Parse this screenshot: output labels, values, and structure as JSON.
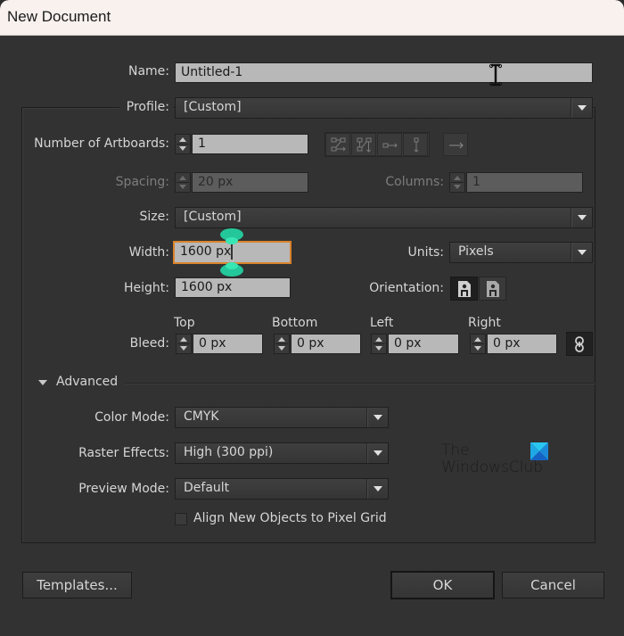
{
  "window": {
    "title": "New Document"
  },
  "form": {
    "name": {
      "label": "Name:",
      "value": "Untitled-1"
    },
    "profile": {
      "label": "Profile:",
      "value": "[Custom]"
    },
    "artboards": {
      "label": "Number of Artboards:",
      "value": "1"
    },
    "artboard_arrange_icons": [
      "grid-by-row-icon",
      "grid-by-column-icon",
      "arrange-by-row-icon",
      "arrange-by-column-icon",
      "right-to-left-layout-icon"
    ],
    "spacing": {
      "label": "Spacing:",
      "value": "20 px",
      "enabled": false
    },
    "columns": {
      "label": "Columns:",
      "value": "1",
      "enabled": false
    },
    "size": {
      "label": "Size:",
      "value": "[Custom]"
    },
    "width": {
      "label": "Width:",
      "value": "1600 px"
    },
    "units": {
      "label": "Units:",
      "value": "Pixels"
    },
    "height": {
      "label": "Height:",
      "value": "1600 px"
    },
    "orientation": {
      "label": "Orientation:",
      "selected": "portrait"
    },
    "bleed": {
      "label": "Bleed:",
      "top": {
        "label": "Top",
        "value": "0 px"
      },
      "bottom": {
        "label": "Bottom",
        "value": "0 px"
      },
      "left": {
        "label": "Left",
        "value": "0 px"
      },
      "right": {
        "label": "Right",
        "value": "0 px"
      },
      "linked": true
    }
  },
  "advanced": {
    "label": "Advanced",
    "expanded": true,
    "color_mode": {
      "label": "Color Mode:",
      "value": "CMYK"
    },
    "raster_effects": {
      "label": "Raster Effects:",
      "value": "High (300 ppi)"
    },
    "preview_mode": {
      "label": "Preview Mode:",
      "value": "Default"
    },
    "align_pixel_grid": {
      "label": "Align New Objects to Pixel Grid",
      "checked": false
    }
  },
  "watermark": {
    "line1": "The",
    "line2": "WindowsClub"
  },
  "buttons": {
    "templates": "Templates...",
    "ok": "OK",
    "cancel": "Cancel"
  },
  "colors": {
    "focus_border": "#d9832c",
    "handle": "#24c79a",
    "title_bg": "#f8f1ee",
    "dialog_bg": "#323232"
  }
}
